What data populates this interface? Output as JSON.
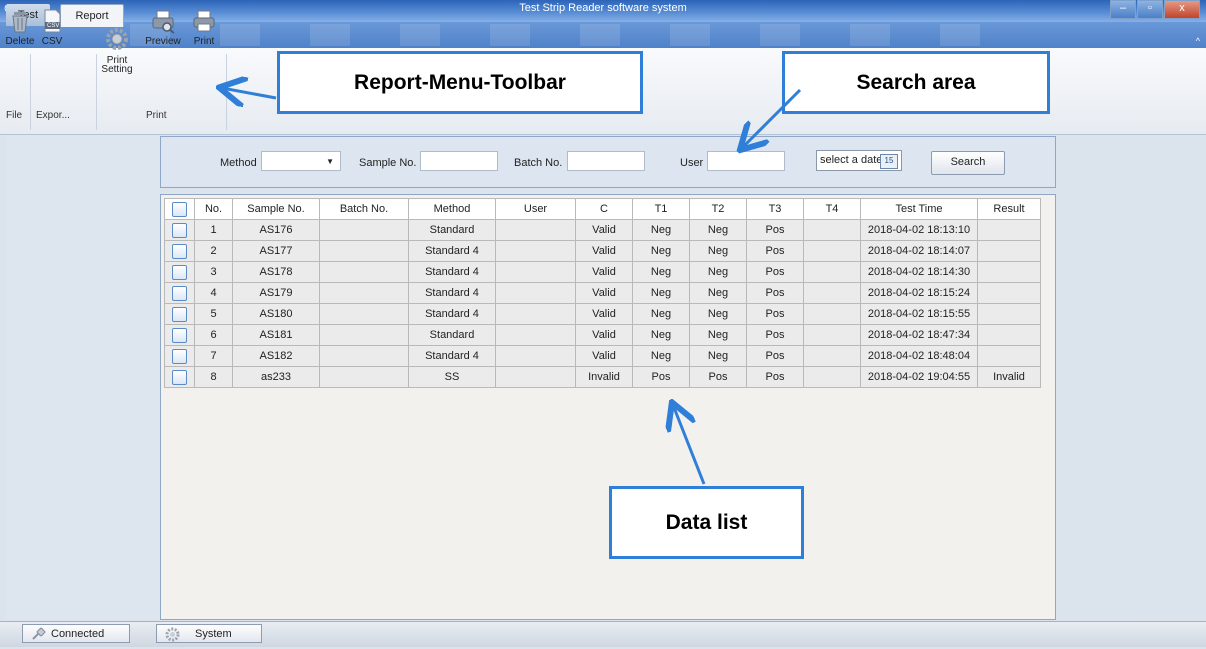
{
  "window": {
    "title": "Test Strip Reader software system",
    "controls": [
      "–",
      "▫",
      "x"
    ],
    "collapse_glyph": "^"
  },
  "ribbon": {
    "tabs": [
      {
        "label": "Test"
      },
      {
        "label": "Report"
      }
    ],
    "tools": {
      "delete": {
        "label": "Delete",
        "icon": "recycle-bin-icon"
      },
      "csv": {
        "label": "CSV",
        "icon": "csv-file-icon",
        "icon_text": "CSV"
      },
      "print_setting": {
        "label": "Print\nSetting",
        "icon": "gear-icon"
      },
      "preview": {
        "label": "Preview",
        "icon": "print-preview-icon"
      },
      "print": {
        "label": "Print",
        "icon": "printer-icon"
      }
    },
    "groups": {
      "file": "File",
      "export": "Expor...",
      "print": "Print"
    }
  },
  "annotations": {
    "toolbar": "Report-Menu-Toolbar",
    "search": "Search area",
    "list": "Data list",
    "arrow_color": "#2f7ed8"
  },
  "search": {
    "method_label": "Method",
    "method_value": "",
    "sample_label": "Sample No.",
    "batch_label": "Batch No.",
    "user_label": "User",
    "date_placeholder": "select a date",
    "date_icon_text": "15",
    "button": "Search"
  },
  "table": {
    "headers": [
      "",
      "No.",
      "Sample No.",
      "Batch No.",
      "Method",
      "User",
      "C",
      "T1",
      "T2",
      "T3",
      "T4",
      "Test Time",
      "Result"
    ],
    "rows": [
      {
        "no": "1",
        "sample": "AS176",
        "batch": "",
        "method": "Standard",
        "user": "",
        "c": "Valid",
        "t1": "Neg",
        "t2": "Neg",
        "t3": "Pos",
        "t4": "",
        "time": "2018-04-02 18:13:10",
        "result": ""
      },
      {
        "no": "2",
        "sample": "AS177",
        "batch": "",
        "method": "Standard 4",
        "user": "",
        "c": "Valid",
        "t1": "Neg",
        "t2": "Neg",
        "t3": "Pos",
        "t4": "",
        "time": "2018-04-02 18:14:07",
        "result": ""
      },
      {
        "no": "3",
        "sample": "AS178",
        "batch": "",
        "method": "Standard 4",
        "user": "",
        "c": "Valid",
        "t1": "Neg",
        "t2": "Neg",
        "t3": "Pos",
        "t4": "",
        "time": "2018-04-02 18:14:30",
        "result": ""
      },
      {
        "no": "4",
        "sample": "AS179",
        "batch": "",
        "method": "Standard 4",
        "user": "",
        "c": "Valid",
        "t1": "Neg",
        "t2": "Neg",
        "t3": "Pos",
        "t4": "",
        "time": "2018-04-02 18:15:24",
        "result": ""
      },
      {
        "no": "5",
        "sample": "AS180",
        "batch": "",
        "method": "Standard 4",
        "user": "",
        "c": "Valid",
        "t1": "Neg",
        "t2": "Neg",
        "t3": "Pos",
        "t4": "",
        "time": "2018-04-02 18:15:55",
        "result": ""
      },
      {
        "no": "6",
        "sample": "AS181",
        "batch": "",
        "method": "Standard",
        "user": "",
        "c": "Valid",
        "t1": "Neg",
        "t2": "Neg",
        "t3": "Pos",
        "t4": "",
        "time": "2018-04-02 18:47:34",
        "result": ""
      },
      {
        "no": "7",
        "sample": "AS182",
        "batch": "",
        "method": "Standard 4",
        "user": "",
        "c": "Valid",
        "t1": "Neg",
        "t2": "Neg",
        "t3": "Pos",
        "t4": "",
        "time": "2018-04-02 18:48:04",
        "result": ""
      },
      {
        "no": "8",
        "sample": "as233",
        "batch": "",
        "method": "SS",
        "user": "",
        "c": "Invalid",
        "t1": "Pos",
        "t2": "Pos",
        "t3": "Pos",
        "t4": "",
        "time": "2018-04-02 19:04:55",
        "result": "Invalid"
      }
    ]
  },
  "statusbar": {
    "connection": {
      "label": "Connected",
      "icon": "plug-icon"
    },
    "system": {
      "label": "System",
      "icon": "gear-icon"
    }
  }
}
